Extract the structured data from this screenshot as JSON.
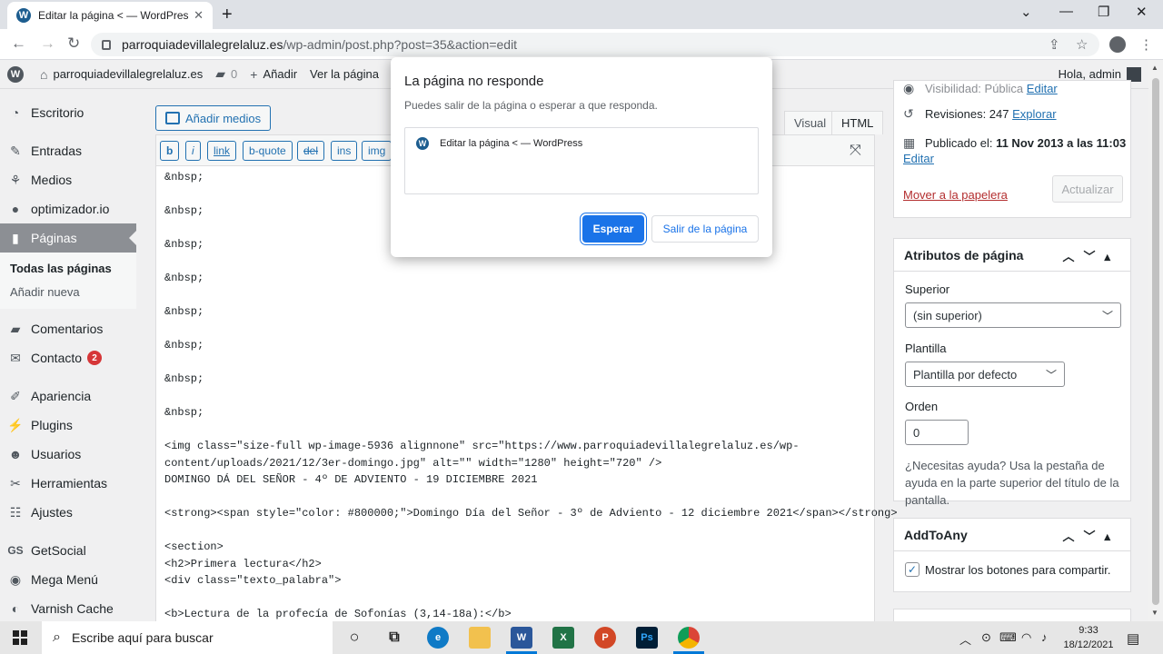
{
  "browser": {
    "tab_title": "Editar la página < — WordPress",
    "tab_icon": "W",
    "url_host": "parroquiadevillalegrelaluz.es",
    "url_path": "/wp-admin/post.php?post=35&action=edit"
  },
  "adminbar": {
    "site_name": "parroquiadevillalegrelaluz.es",
    "comments_count": "0",
    "add_label": "Añadir",
    "view_label": "Ver la página",
    "greeting": "Hola, admin"
  },
  "sidebar": {
    "items": [
      {
        "label": "Escritorio",
        "icon": "dashboard-icon"
      },
      {
        "label": "Entradas",
        "icon": "pin-icon"
      },
      {
        "label": "Medios",
        "icon": "media-icon"
      },
      {
        "label": "optimizador.io",
        "icon": "optimizer-icon"
      },
      {
        "label": "Páginas",
        "icon": "pages-icon"
      },
      {
        "label": "Comentarios",
        "icon": "comments-icon"
      },
      {
        "label": "Contacto",
        "icon": "mail-icon",
        "badge": "2"
      },
      {
        "label": "Apariencia",
        "icon": "brush-icon"
      },
      {
        "label": "Plugins",
        "icon": "plugin-icon"
      },
      {
        "label": "Usuarios",
        "icon": "user-icon"
      },
      {
        "label": "Herramientas",
        "icon": "wrench-icon"
      },
      {
        "label": "Ajustes",
        "icon": "settings-icon"
      },
      {
        "label": "GetSocial",
        "icon": "getsocial-icon"
      },
      {
        "label": "Mega Menú",
        "icon": "megamenu-icon"
      },
      {
        "label": "Varnish Cache",
        "icon": "varnish-icon"
      }
    ],
    "sub_items": [
      "Todas las páginas",
      "Añadir nueva"
    ]
  },
  "editor": {
    "add_media": "Añadir medios",
    "tab_visual": "Visual",
    "tab_html": "HTML",
    "toolbar": [
      "b",
      "i",
      "link",
      "b-quote",
      "del",
      "ins",
      "img"
    ],
    "lines": [
      "&nbsp;",
      "",
      "&nbsp;",
      "",
      "&nbsp;",
      "",
      "&nbsp;",
      "",
      "&nbsp;",
      "",
      "&nbsp;",
      "",
      "&nbsp;",
      "",
      "&nbsp;",
      "",
      "<img class=\"size-full wp-image-5936 alignnone\" src=\"https://www.parroquiadevillalegrelaluz.es/wp-",
      "content/uploads/2021/12/3er-domingo.jpg\" alt=\"\" width=\"1280\" height=\"720\" />",
      "DOMINGO DÁ DEL SEÑOR - 4º DE ADVIENTO - 19 DICIEMBRE 2021",
      "",
      "<strong><span style=\"color: #800000;\">Domingo Día del Señor - 3º de Adviento - 12 diciembre 2021</span></strong>",
      "",
      "<section>",
      "<h2>Primera lectura</h2>",
      "<div class=\"texto_palabra\">",
      "",
      "<b>Lectura de la profecía de Sofonías (3,14-18a):</b>"
    ]
  },
  "publish": {
    "visibility": "Visibilidad: Pública",
    "visibility_edit": "Editar",
    "revisions_label": "Revisiones: 247",
    "revisions_link": "Explorar",
    "published_prefix": "Publicado el:",
    "published_date": "11 Nov 2013 a las 11:03",
    "published_edit": "Editar",
    "trash": "Mover a la papelera",
    "update": "Actualizar"
  },
  "page_attributes": {
    "title": "Atributos de página",
    "parent_label": "Superior",
    "parent_value": "(sin superior)",
    "template_label": "Plantilla",
    "template_value": "Plantilla por defecto",
    "order_label": "Orden",
    "order_value": "0",
    "help": "¿Necesitas ayuda? Usa la pestaña de ayuda en la parte superior del título de la pantalla."
  },
  "addtoany": {
    "title": "AddToAny",
    "checkbox_label": "Mostrar los botones para compartir."
  },
  "dialog": {
    "title": "La página no responde",
    "message": "Puedes salir de la página o esperar a que responda.",
    "item": "Editar la página < — WordPress",
    "wait": "Esperar",
    "leave": "Salir de la página"
  },
  "taskbar": {
    "search_placeholder": "Escribe aquí para buscar",
    "time": "9:33",
    "date": "18/12/2021"
  },
  "colors": {
    "accent": "#2271b1",
    "chrome_blue": "#1a73e8",
    "danger": "#b32d2e"
  }
}
